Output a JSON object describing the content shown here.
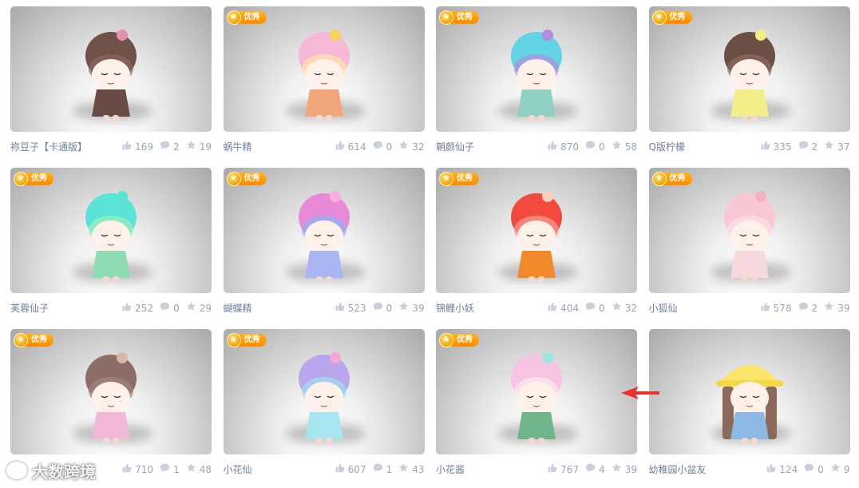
{
  "badge_label": "优秀",
  "cards": [
    {
      "title": "祢豆子【卡通版】",
      "likes": "169",
      "comments": "2",
      "stars": "19",
      "featured": false,
      "hair": "#6e5148",
      "hair2": "#8a6a5e",
      "outfit": "#6a4a44",
      "accent": "#e58fb0"
    },
    {
      "title": "蜗牛精",
      "likes": "614",
      "comments": "0",
      "stars": "32",
      "featured": true,
      "hair": "#f6b8d6",
      "hair2": "#fde7a6",
      "outfit": "#f2a67c",
      "accent": "#f7d35a"
    },
    {
      "title": "朝颜仙子",
      "likes": "870",
      "comments": "0",
      "stars": "58",
      "featured": true,
      "hair": "#62d4e4",
      "hair2": "#b58be0",
      "outfit": "#8fd0c3",
      "accent": "#b58be0"
    },
    {
      "title": "Q版柠檬",
      "likes": "335",
      "comments": "2",
      "stars": "37",
      "featured": true,
      "hair": "#6b4f45",
      "hair2": "#8c6b5f",
      "outfit": "#f4ee8a",
      "accent": "#f4ee8a"
    },
    {
      "title": "芙蓉仙子",
      "likes": "252",
      "comments": "0",
      "stars": "29",
      "featured": true,
      "hair": "#5ae4d8",
      "hair2": "#9ff0b9",
      "outfit": "#8fdcb4",
      "accent": "#5ae4d8"
    },
    {
      "title": "蝴蝶精",
      "likes": "523",
      "comments": "0",
      "stars": "39",
      "featured": true,
      "hair": "#e88ad8",
      "hair2": "#8fb4f4",
      "outfit": "#a9b6f2",
      "accent": "#f7b0e0"
    },
    {
      "title": "锦鲤小妖",
      "likes": "404",
      "comments": "0",
      "stars": "32",
      "featured": true,
      "hair": "#f04b3c",
      "hair2": "#f79c95",
      "outfit": "#f08a2c",
      "accent": "#ffd0c0"
    },
    {
      "title": "小狐仙",
      "likes": "578",
      "comments": "2",
      "stars": "39",
      "featured": true,
      "hair": "#f8c8d4",
      "hair2": "#fbdfe6",
      "outfit": "#f7d8dc",
      "accent": "#f5b0c4"
    },
    {
      "title": "",
      "likes": "710",
      "comments": "1",
      "stars": "48",
      "featured": true,
      "hair": "#8b6c66",
      "hair2": "#a58580",
      "outfit": "#f2b8d8",
      "accent": "#d9b7a8"
    },
    {
      "title": "小花仙",
      "likes": "607",
      "comments": "1",
      "stars": "43",
      "featured": true,
      "hair": "#b9a6ec",
      "hair2": "#9fe0f0",
      "outfit": "#a8e6ef",
      "accent": "#f6a6d8"
    },
    {
      "title": "小花酱",
      "likes": "767",
      "comments": "4",
      "stars": "39",
      "featured": true,
      "hair": "#f7c4e4",
      "hair2": "#fde8f2",
      "outfit": "#6fb58b",
      "accent": "#9ee4e0"
    },
    {
      "title": "幼稚园小盆友",
      "likes": "124",
      "comments": "0",
      "stars": "9",
      "featured": false,
      "hair": "#8b6a5c",
      "hair2": "#a88475",
      "outfit": "#8db8e4",
      "accent": "#fbe46a"
    }
  ],
  "watermark": "大数跨境",
  "colors": {
    "badge": "#ff9a00",
    "meta_text": "#7a8ba6",
    "arrow": "#e8302c"
  },
  "icons": {
    "likes": "thumbs-up-icon",
    "comments": "comment-bubble-icon",
    "stars": "star-icon"
  }
}
